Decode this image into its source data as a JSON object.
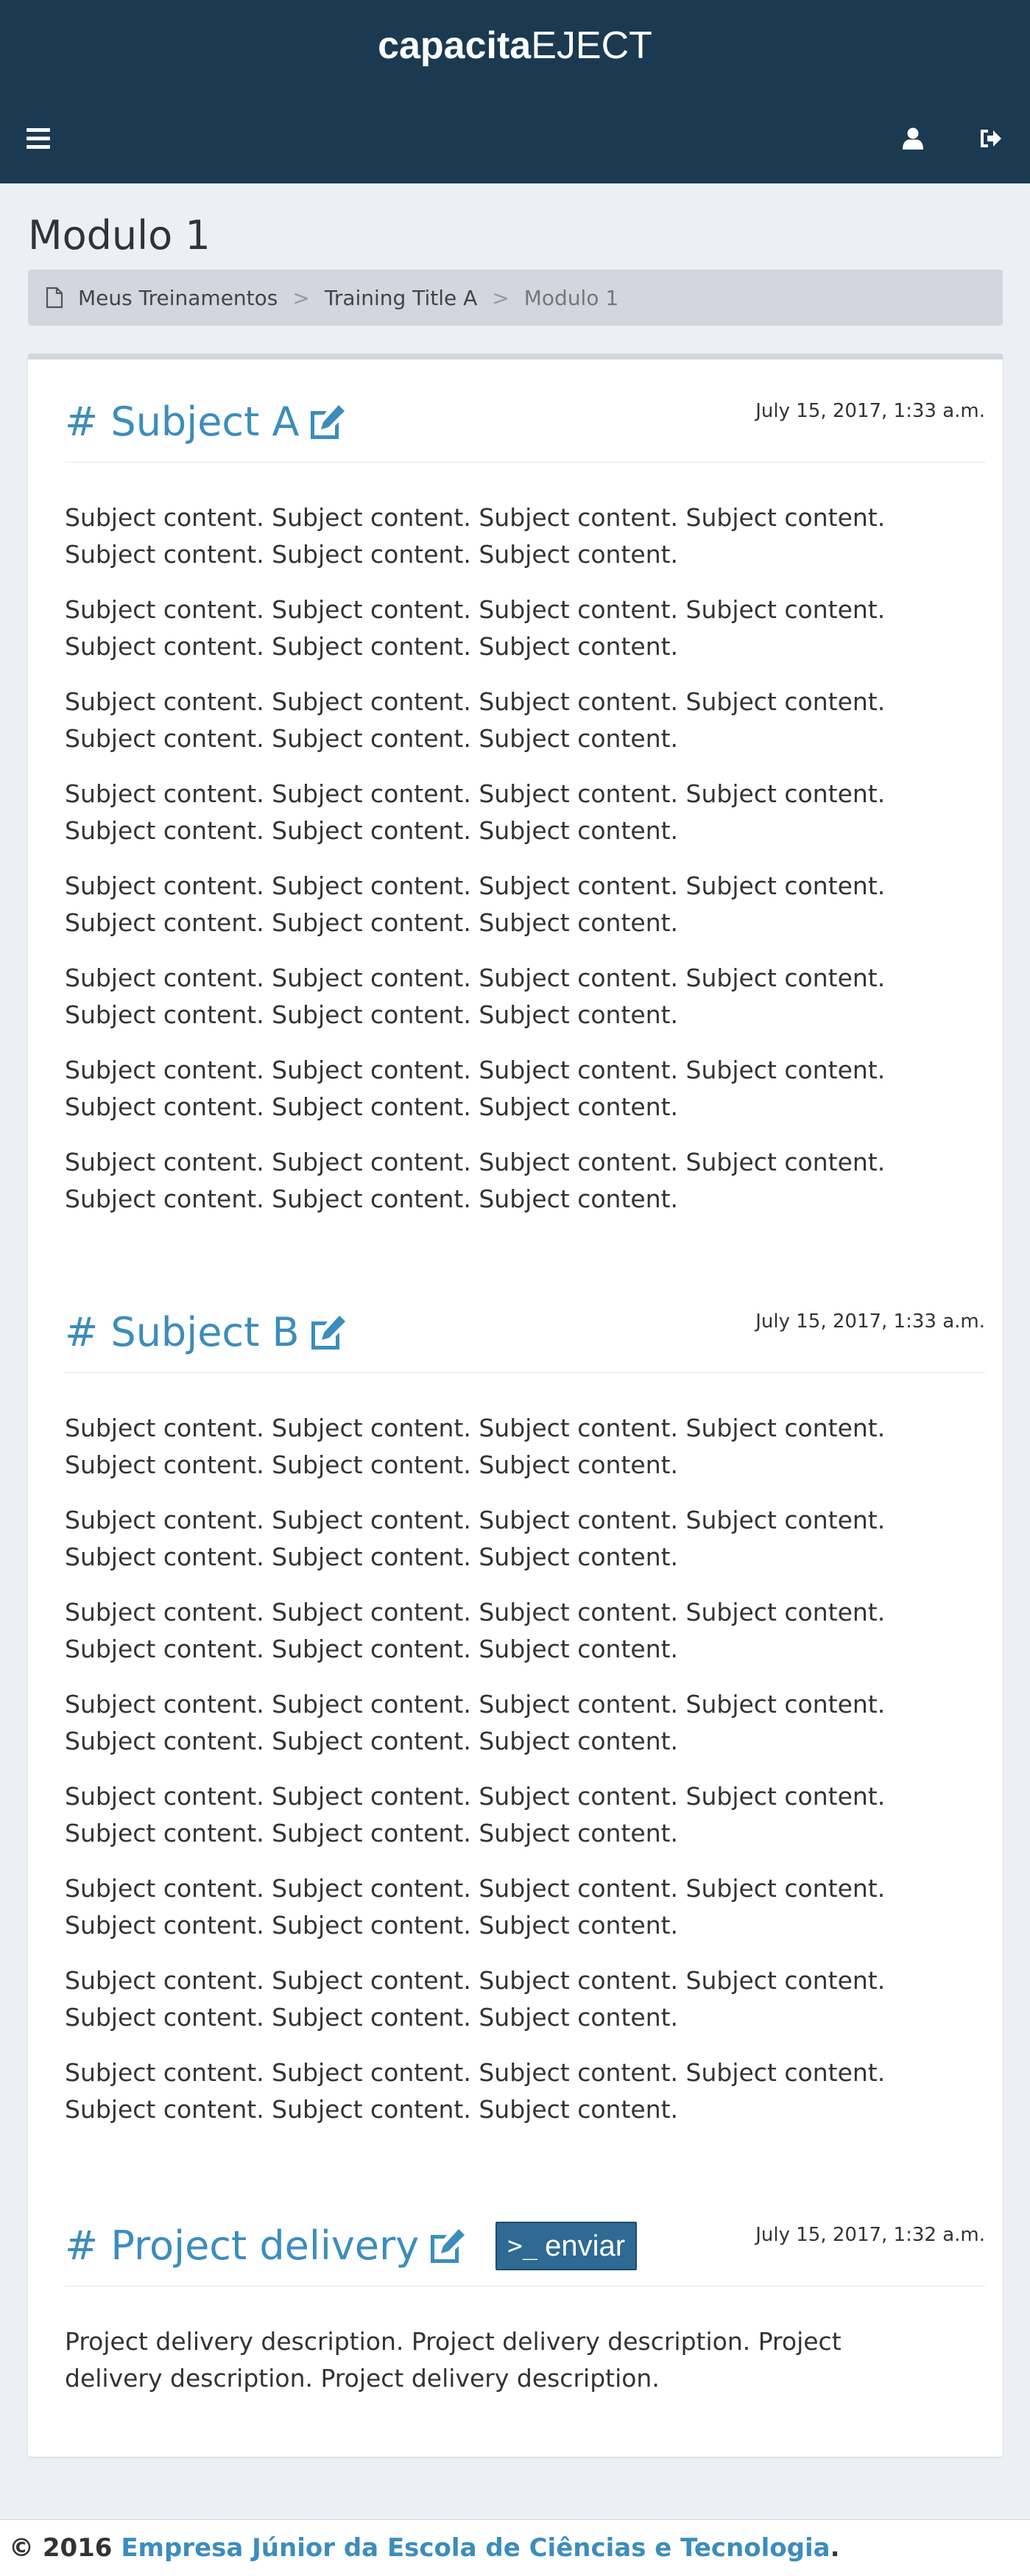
{
  "header": {
    "brand_bold": "capacita",
    "brand_regular": "EJECT",
    "menu_icon": "bars-icon",
    "user_icon": "user-icon",
    "logout_icon": "sign-out-icon"
  },
  "page": {
    "title": "Modulo 1"
  },
  "breadcrumb": {
    "icon": "file-icon",
    "items": [
      "Meus Treinamentos",
      "Training Title A",
      "Modulo 1"
    ],
    "separator": ">"
  },
  "sections": [
    {
      "title": "# Subject A",
      "date": "July 15, 2017, 1:33 a.m.",
      "paragraphs": [
        "Subject content. Subject content. Subject content. Subject content. Subject content. Subject content. Subject content.",
        "Subject content. Subject content. Subject content. Subject content. Subject content. Subject content. Subject content.",
        "Subject content. Subject content. Subject content. Subject content. Subject content. Subject content. Subject content.",
        "Subject content. Subject content. Subject content. Subject content. Subject content. Subject content. Subject content.",
        "Subject content. Subject content. Subject content. Subject content. Subject content. Subject content. Subject content.",
        "Subject content. Subject content. Subject content. Subject content. Subject content. Subject content. Subject content.",
        "Subject content. Subject content. Subject content. Subject content. Subject content. Subject content. Subject content.",
        "Subject content. Subject content. Subject content. Subject content. Subject content. Subject content. Subject content."
      ]
    },
    {
      "title": "# Subject B",
      "date": "July 15, 2017, 1:33 a.m.",
      "paragraphs": [
        "Subject content. Subject content. Subject content. Subject content. Subject content. Subject content. Subject content.",
        "Subject content. Subject content. Subject content. Subject content. Subject content. Subject content. Subject content.",
        "Subject content. Subject content. Subject content. Subject content. Subject content. Subject content. Subject content.",
        "Subject content. Subject content. Subject content. Subject content. Subject content. Subject content. Subject content.",
        "Subject content. Subject content. Subject content. Subject content. Subject content. Subject content. Subject content.",
        "Subject content. Subject content. Subject content. Subject content. Subject content. Subject content. Subject content.",
        "Subject content. Subject content. Subject content. Subject content. Subject content. Subject content. Subject content.",
        "Subject content. Subject content. Subject content. Subject content. Subject content. Subject content. Subject content."
      ]
    },
    {
      "title": "# Project delivery",
      "date": "July 15, 2017, 1:32 a.m.",
      "send_label": "enviar",
      "send_icon": ">_",
      "paragraphs": [
        "Project delivery description. Project delivery description. Project delivery description. Project delivery description."
      ]
    }
  ],
  "footer": {
    "prefix": "© 2016",
    "link": "Empresa Júnior da Escola de Ciências e Tecnologia",
    "suffix": "."
  },
  "colors": {
    "header_bg": "#1b3a52",
    "accent": "#3c8dbc",
    "page_bg": "#ecf0f5",
    "breadcrumb_bg": "#d2d6de",
    "send_button_bg": "#2e6a93"
  }
}
